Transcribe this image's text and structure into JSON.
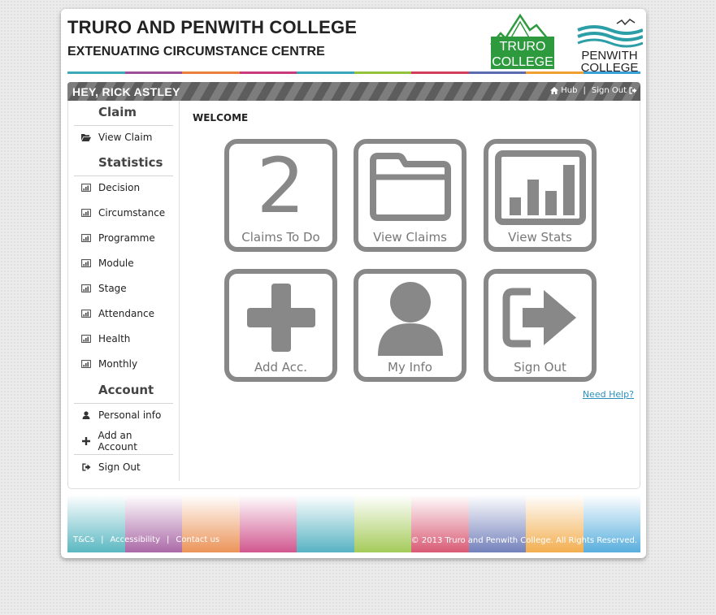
{
  "header": {
    "title": "TRURO AND PENWITH COLLEGE",
    "subtitle": "EXTENUATING CIRCUMSTANCE CENTRE",
    "logo_truro_line1": "TRURO",
    "logo_truro_line2": "COLLEGE",
    "logo_penwith_line1": "PENWITH",
    "logo_penwith_line2": "COLLEGE",
    "stripe_colors": [
      "#3dabb7",
      "#9c4f98",
      "#e8813b",
      "#c93a7c",
      "#3aa5b8",
      "#95c23d",
      "#d23d5c",
      "#5b6bb0",
      "#f0a030",
      "#3aa0d8"
    ]
  },
  "userbar": {
    "greeting": "HEY, RICK ASTLEY",
    "hub_label": "Hub",
    "separator": "|",
    "signout_label": "Sign Out"
  },
  "sidebar": {
    "claim_heading": "Claim",
    "claim_items": [
      {
        "label": "View Claim",
        "icon": "folder-open-icon"
      }
    ],
    "statistics_heading": "Statistics",
    "statistics_items": [
      {
        "label": "Decision",
        "icon": "bar-chart-icon"
      },
      {
        "label": "Circumstance",
        "icon": "bar-chart-icon"
      },
      {
        "label": "Programme",
        "icon": "bar-chart-icon"
      },
      {
        "label": "Module",
        "icon": "bar-chart-icon"
      },
      {
        "label": "Stage",
        "icon": "bar-chart-icon"
      },
      {
        "label": "Attendance",
        "icon": "bar-chart-icon"
      },
      {
        "label": "Health",
        "icon": "bar-chart-icon"
      },
      {
        "label": "Monthly",
        "icon": "bar-chart-icon"
      }
    ],
    "account_heading": "Account",
    "account_items": [
      {
        "label": "Personal info",
        "icon": "user-icon"
      },
      {
        "label": "Add an Account",
        "icon": "plus-icon"
      },
      {
        "label": "Sign Out",
        "icon": "sign-out-icon"
      }
    ]
  },
  "main": {
    "welcome": "WELCOME",
    "tiles": [
      {
        "label": "Claims To Do",
        "number": "2"
      },
      {
        "label": "View Claims",
        "icon": "folder-icon"
      },
      {
        "label": "View Stats",
        "icon": "bar-chart-icon"
      },
      {
        "label": "Add Acc.",
        "icon": "plus-icon"
      },
      {
        "label": "My Info",
        "icon": "user-icon"
      },
      {
        "label": "Sign Out",
        "icon": "sign-out-icon"
      }
    ],
    "help_link": "Need Help?"
  },
  "footer": {
    "links": [
      "T&Cs",
      "Accessibility",
      "Contact us"
    ],
    "separator": "|",
    "copyright": "© 2013 Truro and Penwith College. All Rights Reserved."
  }
}
